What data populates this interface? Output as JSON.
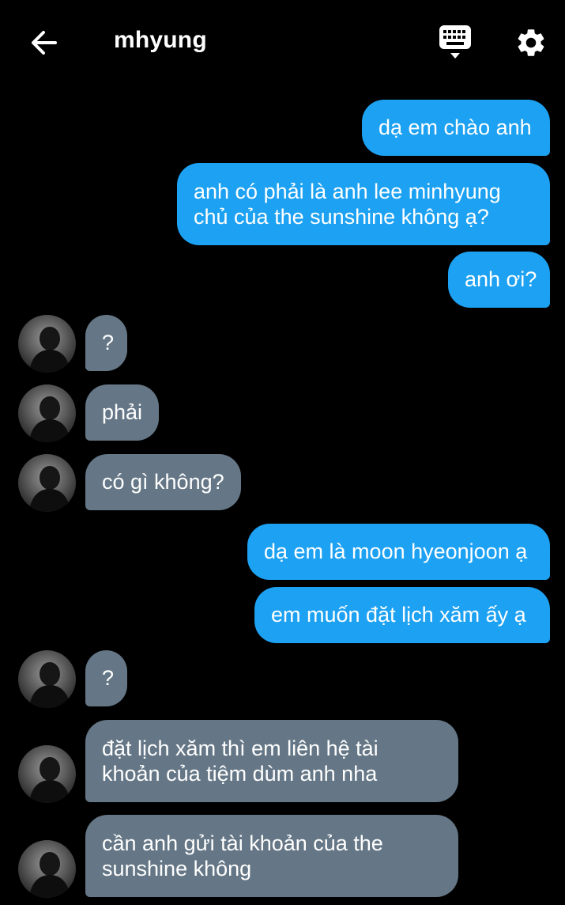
{
  "header": {
    "title": "mhyung",
    "back_icon": "arrow-left-icon",
    "keyboard_icon": "keyboard-icon",
    "settings_icon": "gear-icon"
  },
  "colors": {
    "background": "#000000",
    "outgoing_bubble": "#1da1f2",
    "incoming_bubble": "#657786",
    "text": "#ffffff"
  },
  "messages": [
    {
      "side": "out",
      "lines": [
        "dạ em chào anh"
      ]
    },
    {
      "side": "out",
      "lines": [
        "anh có phải là anh lee minhyung",
        "chủ của the sunshine không ạ?"
      ]
    },
    {
      "side": "out",
      "lines": [
        "anh ơi?"
      ]
    },
    {
      "side": "in",
      "lines": [
        "?"
      ]
    },
    {
      "side": "in",
      "lines": [
        "phải"
      ]
    },
    {
      "side": "in",
      "lines": [
        "có gì không?"
      ]
    },
    {
      "side": "out",
      "lines": [
        "dạ em là moon hyeonjoon ạ"
      ]
    },
    {
      "side": "out",
      "lines": [
        "em muốn đặt lịch xăm ấy ạ"
      ]
    },
    {
      "side": "in",
      "lines": [
        "?"
      ]
    },
    {
      "side": "in",
      "lines": [
        "đặt lịch xăm thì em liên hệ tài",
        "khoản của tiệm dùm anh nha"
      ]
    },
    {
      "side": "in",
      "lines": [
        "cần anh gửi tài khoản của the",
        "sunshine không"
      ]
    }
  ]
}
